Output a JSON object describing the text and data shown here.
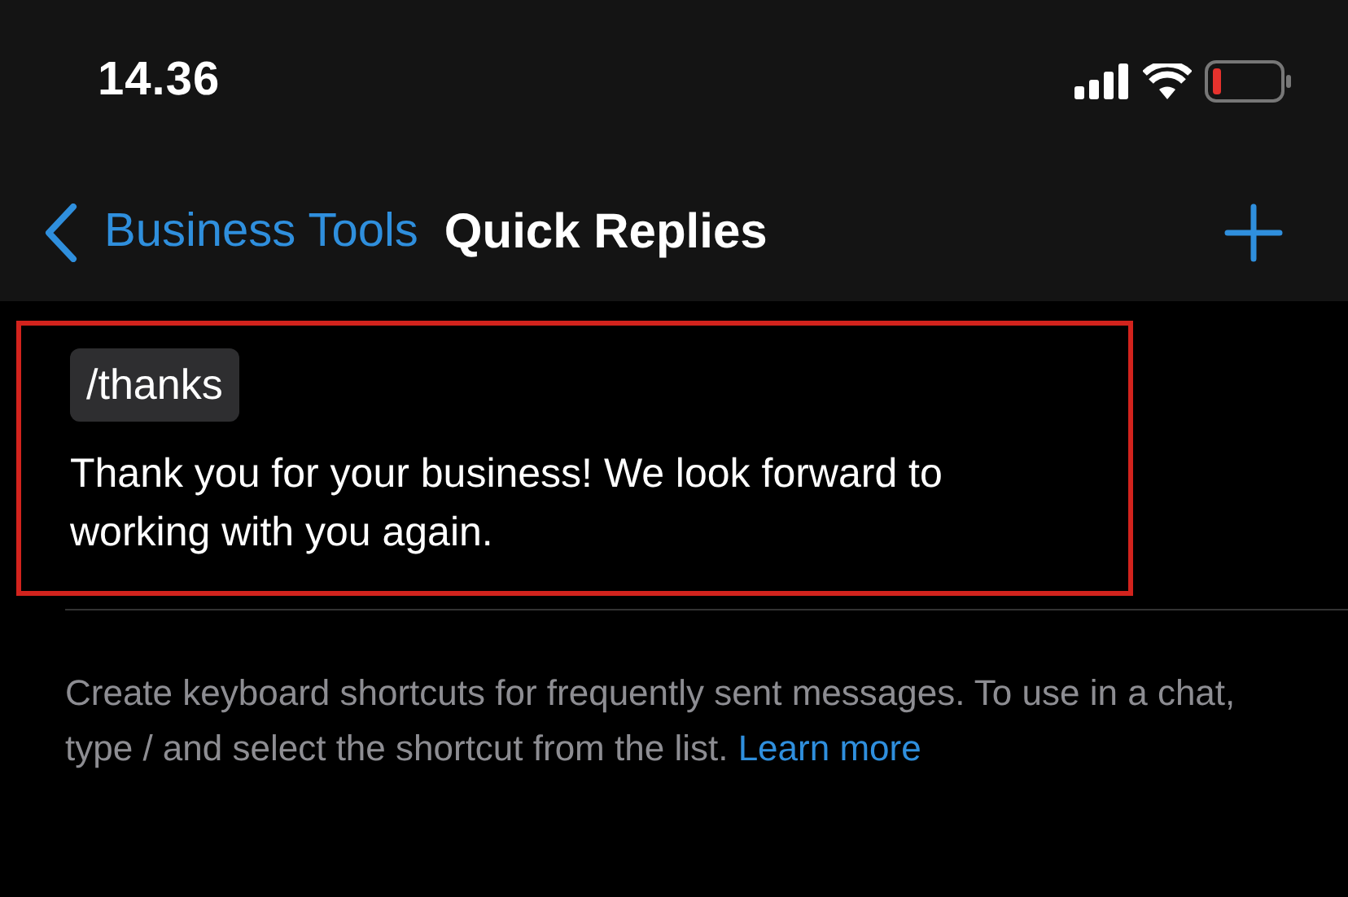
{
  "status_bar": {
    "time": "14.36"
  },
  "nav": {
    "back_label": "Business Tools",
    "title": "Quick Replies"
  },
  "quick_replies": [
    {
      "shortcut": "/thanks",
      "message": "Thank you for your business! We look forward to working with you again.",
      "highlighted": true
    }
  ],
  "footer": {
    "text": "Create keyboard shortcuts for frequently sent messages. To use in a chat, type / and select the shortcut from the list.",
    "link": "Learn more"
  }
}
